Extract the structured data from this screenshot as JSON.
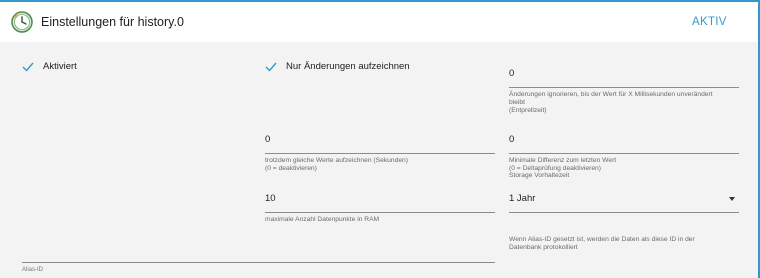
{
  "header": {
    "title": "Einstellungen für history.0",
    "status": "AKTIV"
  },
  "checkboxes": {
    "enabled": {
      "label": "Aktiviert",
      "checked": true
    },
    "changes_only": {
      "label": "Nur Änderungen aufzeichnen",
      "checked": true
    }
  },
  "fields": {
    "debounce": {
      "value": "0",
      "help_line1": "Änderungen ignorieren, bis der Wert für X Millisekunden unverändert",
      "help_line2": "bleibt",
      "help_line3": "(Entprellzeit)"
    },
    "record_same_values": {
      "value": "0",
      "help_line1": "trotzdem gleiche Werte aufzeichnen (Sekunden)",
      "help_line2": "(0 = deaktivieren)"
    },
    "min_difference": {
      "value": "0",
      "help_line1": "Minimale Differenz zum letzten Wert",
      "help_line2": "(0 = Deltaprüfung deaktivieren)",
      "help_line3": "Storage Vorhaltezeit"
    },
    "max_points": {
      "value": "10",
      "help": "maximale Anzahl Datenpunkte in RAM"
    },
    "retention": {
      "value": "1 Jahr",
      "help_line1": "Wenn Alias-ID gesetzt ist, werden die Daten als diese ID in der",
      "help_line2": "Datenbank protokolliert"
    },
    "alias": {
      "label": "Alias-ID"
    }
  },
  "colors": {
    "accent": "#3399cc",
    "background": "#f3f3f3"
  },
  "icons": {
    "app": "clock-icon",
    "check": "check-icon",
    "dropdown": "caret-down-icon"
  }
}
